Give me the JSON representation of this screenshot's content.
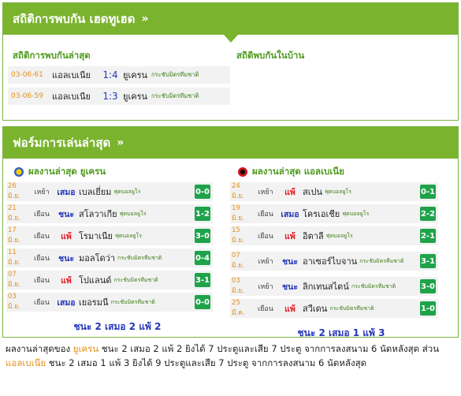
{
  "h2h": {
    "header": "สถิติการพบกัน เฮดทูเฮด",
    "chevron": "»",
    "recent_title": "สถิติการพบกันล่าสุด",
    "home_title": "สถิติพบกันในบ้าน",
    "matches": [
      {
        "date": "03-06-61",
        "team1": "แอลเบเนีย",
        "score": "1:4",
        "team2": "ยูเครน",
        "comp": "กระชับมิตรทีมชาติ"
      },
      {
        "date": "03-06-59",
        "team1": "แอลเบเนีย",
        "score": "1:3",
        "team2": "ยูเครน",
        "comp": "กระชับมิตรทีมชาติ"
      }
    ]
  },
  "form": {
    "header": "ฟอร์มการเล่นล่าสุด",
    "chevron": "»",
    "left": {
      "title": "ผลงานล่าสุด ยูเครน",
      "badge_icon": "ukraine-crest-icon",
      "rows": [
        {
          "date": "26 มิ.ย.",
          "ha": "เหย้า",
          "result": "เสมอ",
          "rtype": "draw",
          "opp": "เบลเยี่ยม",
          "comp": "ฟุตบอลยูโร",
          "score": "0-0"
        },
        {
          "date": "21 มิ.ย.",
          "ha": "เยือน",
          "result": "ชนะ",
          "rtype": "win",
          "opp": "สโลวาเกีย",
          "comp": "ฟุตบอลยูโร",
          "score": "1-2"
        },
        {
          "date": "17 มิ.ย.",
          "ha": "เยือน",
          "result": "แพ้",
          "rtype": "lose",
          "opp": "โรมาเนีย",
          "comp": "ฟุตบอลยูโร",
          "score": "3-0"
        },
        {
          "date": "11 มิ.ย.",
          "ha": "เยือน",
          "result": "ชนะ",
          "rtype": "win",
          "opp": "มอลโดว่า",
          "comp": "กระชับมิตรทีมชาติ",
          "score": "0-4"
        },
        {
          "date": "07 มิ.ย.",
          "ha": "เยือน",
          "result": "แพ้",
          "rtype": "lose",
          "opp": "โปแลนด์",
          "comp": "กระชับมิตรทีมชาติ",
          "score": "3-1"
        },
        {
          "date": "03 มิ.ย.",
          "ha": "เยือน",
          "result": "เสมอ",
          "rtype": "draw",
          "opp": "เยอรมนี",
          "comp": "กระชับมิตรทีมชาติ",
          "score": "0-0"
        }
      ],
      "summary": "ชนะ 2 เสมอ 2 แพ้ 2"
    },
    "right": {
      "title": "ผลงานล่าสุด แอลเบเนีย",
      "badge_icon": "albania-crest-icon",
      "rows": [
        {
          "date": "24 มิ.ย.",
          "ha": "เหย้า",
          "result": "แพ้",
          "rtype": "lose",
          "opp": "สเปน",
          "comp": "ฟุตบอลยูโร",
          "score": "0-1"
        },
        {
          "date": "19 มิ.ย.",
          "ha": "เยือน",
          "result": "เสมอ",
          "rtype": "draw",
          "opp": "โครเอเชีย",
          "comp": "ฟุตบอลยูโร",
          "score": "2-2"
        },
        {
          "date": "15 มิ.ย.",
          "ha": "เยือน",
          "result": "แพ้",
          "rtype": "lose",
          "opp": "อิตาลี",
          "comp": "ฟุตบอลยูโร",
          "score": "2-1"
        },
        {
          "date": "07 มิ.ย.",
          "ha": "เหย้า",
          "result": "ชนะ",
          "rtype": "win",
          "opp": "อาเซอร์ไบจาน",
          "comp": "กระชับมิตรทีมชาติ",
          "score": "3-1"
        },
        {
          "date": "03 มิ.ย.",
          "ha": "เหย้า",
          "result": "ชนะ",
          "rtype": "win",
          "opp": "ลิกเทนสไตน์",
          "comp": "กระชับมิตรทีมชาติ",
          "score": "3-0"
        },
        {
          "date": "25 มี.ค.",
          "ha": "เยือน",
          "result": "แพ้",
          "rtype": "lose",
          "opp": "สวีเดน",
          "comp": "กระชับมิตรทีมชาติ",
          "score": "1-0"
        }
      ],
      "summary": "ชนะ 2 เสมอ 1 แพ้ 3"
    }
  },
  "footer": {
    "p1": "ผลงานล่าสุดของ ",
    "team1": "ยูเครน",
    "p2": " ชนะ 2 เสมอ 2 แพ้ 2 ยิงได้ 7 ประตูและเสีย 7 ประตู จากการลงสนาม 6 นัดหลังสุด ส่วน ",
    "team2": "แอลเบเนีย",
    "p3": " ชนะ 2 เสมอ 1 แพ้ 3 ยิงได้ 9 ประตูและเสีย 7 ประตู จากการลงสนาม 6 นัดหลังสุด"
  },
  "colors": {
    "accent": "#7ab32e",
    "win": "#2436b8",
    "lose": "#e31b23",
    "date": "#e3911a",
    "score_box": "#1fa34a"
  }
}
